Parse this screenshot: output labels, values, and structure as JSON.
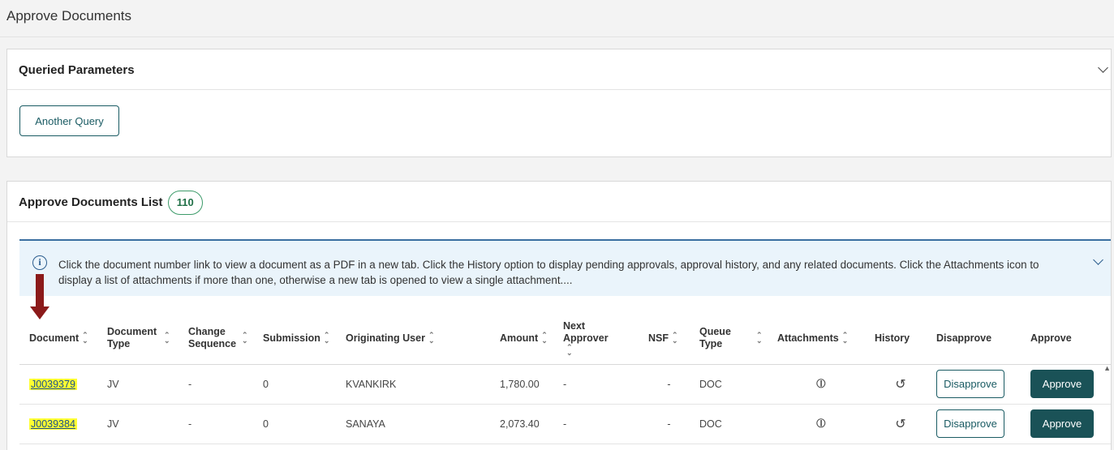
{
  "page": {
    "title": "Approve Documents"
  },
  "query_card": {
    "title": "Queried Parameters",
    "another_query": "Another Query"
  },
  "list_card": {
    "title": "Approve Documents List",
    "count": "110",
    "info_text": "Click the document number link to view a document as a PDF in a new tab. Click the History option to display pending approvals, approval history, and any related documents. Click the Attachments icon to display a list of attachments if more than one, otherwise a new tab is opened to view a single attachment...."
  },
  "table": {
    "columns": [
      {
        "label": "Document",
        "sortable": true
      },
      {
        "label": "Document Type",
        "sortable": true
      },
      {
        "label": "Change Sequence",
        "sortable": true
      },
      {
        "label": "Submission",
        "sortable": true
      },
      {
        "label": "Originating User",
        "sortable": true
      },
      {
        "label": "Amount",
        "sortable": true
      },
      {
        "label": "Next Approver",
        "sortable": true
      },
      {
        "label": "NSF",
        "sortable": true
      },
      {
        "label": "Queue Type",
        "sortable": true
      },
      {
        "label": "Attachments",
        "sortable": true
      },
      {
        "label": "History",
        "sortable": false
      },
      {
        "label": "Disapprove",
        "sortable": false
      },
      {
        "label": "Approve",
        "sortable": false
      }
    ],
    "rows": [
      {
        "document": "J0039379",
        "type": "JV",
        "change_seq": "-",
        "submission": "0",
        "user": "KVANKIRK",
        "amount": "1,780.00",
        "next_approver": "-",
        "nsf": "-",
        "queue": "DOC",
        "disapprove": "Disapprove",
        "approve": "Approve"
      },
      {
        "document": "J0039384",
        "type": "JV",
        "change_seq": "-",
        "submission": "0",
        "user": "SANAYA",
        "amount": "2,073.40",
        "next_approver": "-",
        "nsf": "-",
        "queue": "DOC",
        "disapprove": "Disapprove",
        "approve": "Approve"
      }
    ]
  },
  "icons": {
    "attachment": "paperclip-icon",
    "history": "history-icon",
    "info": "info-icon"
  },
  "colors": {
    "accent": "#1a5b63",
    "approve_bg": "#1a5257",
    "highlight": "#ffff33",
    "arrow": "#8b1a1a"
  }
}
